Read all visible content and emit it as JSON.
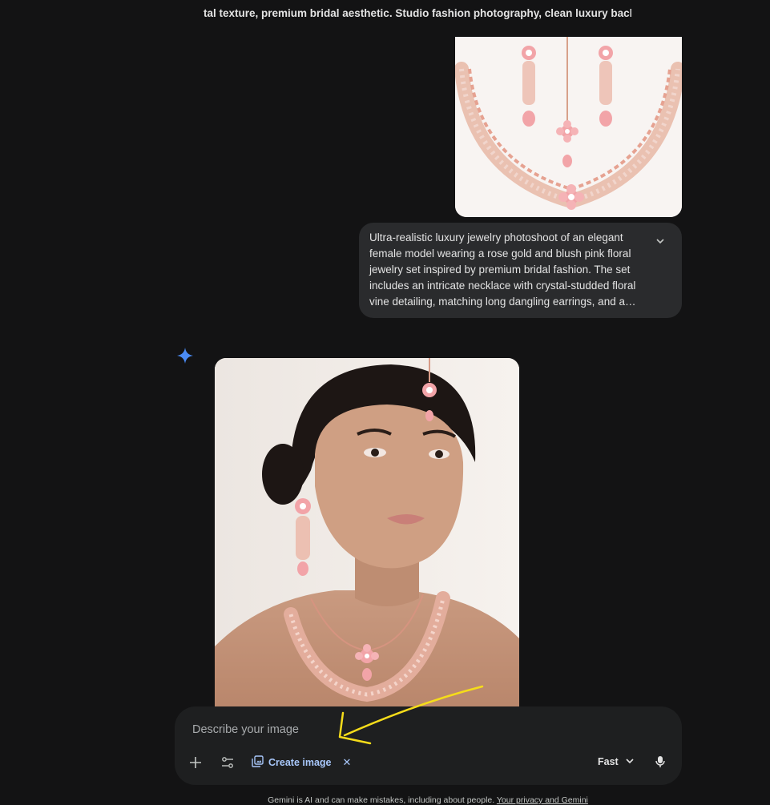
{
  "conversation": {
    "previous_prompt_tail": "tal texture, premium bridal aesthetic. Studio fashion photography, clean luxury backgr",
    "uploaded_image_alt": "Rose gold and blush pink floral bridal necklace set with maang tikka and earrings",
    "user_prompt": "Ultra-realistic luxury jewelry photoshoot of an elegant female model wearing a rose gold and blush pink floral jewelry set inspired by premium bridal fashion. The set includes an intricate necklace with crystal-studded floral vine detailing, matching long dangling earrings, and a…",
    "response_image_alt": "Model wearing rose gold and blush pink floral jewelry set"
  },
  "composer": {
    "placeholder": "Describe your image",
    "tool_chip_label": "Create image",
    "mode_label": "Fast"
  },
  "footer": {
    "disclaimer": "Gemini is AI and can make mistakes, including about people.",
    "link_text": "Your privacy and Gemini"
  },
  "icons": {
    "gemini": "gemini-sparkle-icon",
    "expand": "chevron-down-icon",
    "add": "plus-icon",
    "tools": "tools-sliders-icon",
    "create_image": "image-gallery-icon",
    "close": "close-icon",
    "mode": "chevron-down-icon",
    "mic": "microphone-icon"
  },
  "colors": {
    "background": "#131314",
    "bubble": "#2a2b2d",
    "composer": "#1e1f20",
    "accent": "#a8c7fa",
    "gemini_star": "#4a8bf5",
    "annotation": "#f5dc1a"
  }
}
